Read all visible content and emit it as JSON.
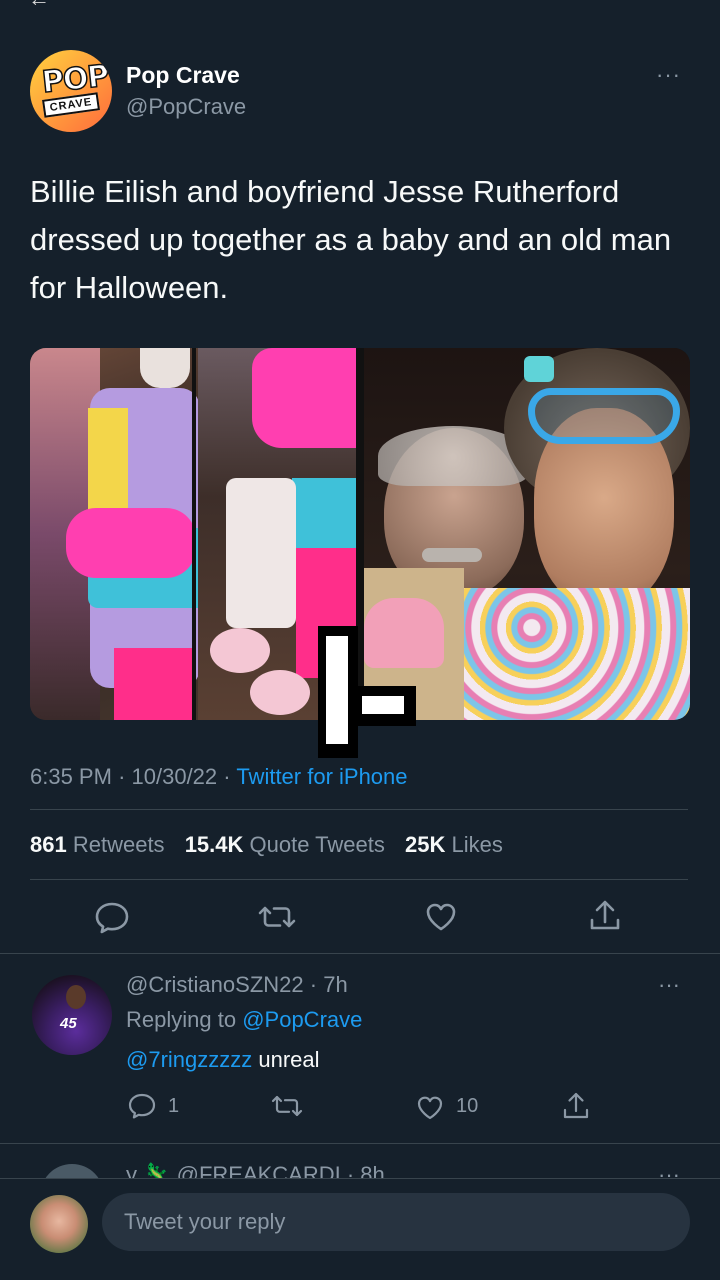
{
  "tweet": {
    "author_name": "Pop Crave",
    "author_handle": "@PopCrave",
    "avatar_text_top": "POP",
    "avatar_text_bottom": "CRAVE",
    "more": "···",
    "text": "Billie Eilish and boyfriend Jesse Rutherford dressed up together as a baby and an old man for Halloween.",
    "time": "6:35 PM",
    "date": "10/30/22",
    "source": "Twitter for iPhone",
    "separator": "·"
  },
  "stats": {
    "retweets_count": "861",
    "retweets_label": "Retweets",
    "quotes_count": "15.4K",
    "quotes_label": "Quote Tweets",
    "likes_count": "25K",
    "likes_label": "Likes"
  },
  "actions": [
    "reply-icon",
    "retweet-icon",
    "like-icon",
    "share-icon"
  ],
  "reply": {
    "handle": "@CristianoSZN22",
    "time": "7h",
    "replying_prefix": "Replying to",
    "replying_to": "@PopCrave",
    "mention": "@7ringzzzzz",
    "text": " unreal",
    "jersey_number": "45",
    "reply_count": "1",
    "like_count": "10",
    "more": "···"
  },
  "next_reply": {
    "partial_text": "y 🦎 @FREAKCARDI · 8h",
    "more": "···"
  },
  "compose": {
    "placeholder": "Tweet your reply"
  },
  "colors": {
    "background": "#15202b",
    "accent": "#1d9bf0",
    "secondary_text": "#8b98a5",
    "divider": "#38444d"
  }
}
